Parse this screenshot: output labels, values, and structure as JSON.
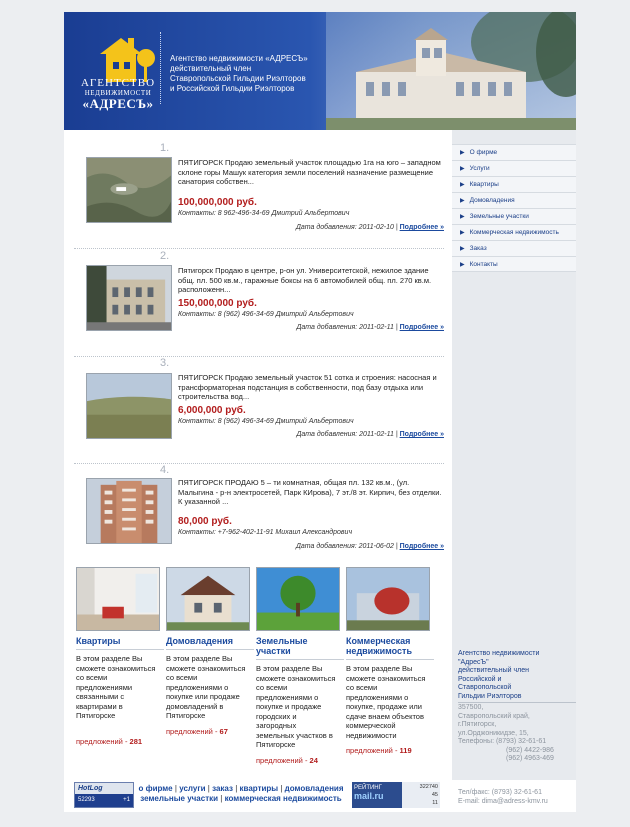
{
  "header": {
    "logo": {
      "line1": "АГЕНТСТВО",
      "line2": "НЕДВИЖИМОСТИ",
      "line3": "«АДРЕСЪ»"
    },
    "tagline": [
      "Агентство недвижимости «АДРЕСЪ»",
      "действительный член",
      "Ставропольской Гильдии Риэлторов",
      "и Российской Гильдии Риэлторов"
    ]
  },
  "nav": {
    "items": [
      {
        "label": "О фирме"
      },
      {
        "label": "Услуги"
      },
      {
        "label": "Квартиры"
      },
      {
        "label": "Домовладения"
      },
      {
        "label": "Земельные участки"
      },
      {
        "label": "Коммерческая недвижимость"
      },
      {
        "label": "Заказ"
      },
      {
        "label": "Контакты"
      }
    ]
  },
  "listings": [
    {
      "num": "1.",
      "desc": "ПЯТИГОРСК Продаю земельный участок площадью 1га на юго – западном склоне горы Машук категория земли поселений назначение размещение санатория собствен...",
      "price": "100,000,000 руб.",
      "contact": "Контакты: 8 962-496-34-69 Дмитрий Альбертович",
      "date": "Дата добавления: 2011-02-10",
      "more": "Подробнее »"
    },
    {
      "num": "2.",
      "desc": "Пятигорск Продаю в центре, р-он ул. Университетской, нежилое здание общ. пл. 500 кв.м., гаражные боксы на 6 автомобилей общ. пл. 270 кв.м. расположенн...",
      "price": "150,000,000 руб.",
      "contact": "Контакты: 8 (962) 496-34-69 Дмитрий Альбертович",
      "date": "Дата добавления: 2011-02-11",
      "more": "Подробнее »"
    },
    {
      "num": "3.",
      "desc": "ПЯТИГОРСК Продаю земельный участок 51 сотка и строения: насосная и трансформаторная подстанция в собственности, под базу отдыха или строительства вод...",
      "price": "6,000,000 руб.",
      "contact": "Контакты: 8 (962) 496-34-69 Дмитрий Альбертович",
      "date": "Дата добавления: 2011-02-11",
      "more": "Подробнее »"
    },
    {
      "num": "4.",
      "desc": "ПЯТИГОРСК ПРОДАЮ 5 – ти комнатная, общая пл. 132 кв.м., (ул. Малыгина - р-н электросетей, Парк КИрова), 7 эт./8 эт. Кирпич, без отделки. К указанной ...",
      "price": "80,000 руб.",
      "contact": "Контакты: +7-962-402-11-91 Михаил Александрович",
      "date": "Дата добавления: 2011-06-02",
      "more": "Подробнее »"
    }
  ],
  "categories": [
    {
      "title": "Квартиры",
      "text": "В этом разделе Вы сможете ознакомиться со всеми предложениями связанными с квартирами в Пятигорске",
      "count_label": "предложений - ",
      "count": "281"
    },
    {
      "title": "Домовладения",
      "text": "В этом разделе Вы сможете ознакомиться со всеми предложениями о покупке или продаже домовладений в Пятигорске",
      "count_label": "предложений - ",
      "count": "67"
    },
    {
      "title": "Земельные участки",
      "text": "В этом разделе Вы сможете ознакомиться со всеми предложениями о покупке и продаже городских и загородных земельных участков в Пятигорске",
      "count_label": "предложений - ",
      "count": "24"
    },
    {
      "title": "Коммерческая недвижимость",
      "text": "В этом разделе Вы сможете ознакомиться со всеми предложениями о покупке, продаже или сдаче внаем объектов коммерческой недвижимости",
      "count_label": "предложений - ",
      "count": "119"
    }
  ],
  "right_contacts": {
    "name": [
      "Агентство недвижимости",
      "\"АдресЪ\"",
      "действительный член",
      "Российской и",
      "Ставропольской",
      "Гильдии Риэлторов"
    ],
    "address": [
      "357500,",
      "Ставропольский край,",
      "г.Пятигорск,",
      "ул.Орджоникидзе, 15,"
    ],
    "phones_label": "Телефоны:",
    "phones": [
      "(8793) 32-61-61",
      "(962) 4422-986",
      "(962) 4963-469"
    ]
  },
  "footer": {
    "links_row1": [
      "о фирме",
      "услуги",
      "заказ",
      "квартиры",
      "домовладения"
    ],
    "links_row2": [
      "земельные участки",
      "коммерческая недвижимость"
    ],
    "counter1": {
      "brand": "HotLog",
      "v1": "52293",
      "v2": "+1"
    },
    "counter2": {
      "brand": "mail.ru",
      "label": "РЕЙТИНГ",
      "v1": "322740",
      "v2": "45",
      "v3": "11"
    },
    "fax": "Тел/факс: (8793) 32-61-61",
    "email": "E-mail: dima@adress-kmv.ru"
  },
  "colors": {
    "accent": "#1b3f88",
    "price": "#b21d1d",
    "link": "#1b4a9e"
  }
}
